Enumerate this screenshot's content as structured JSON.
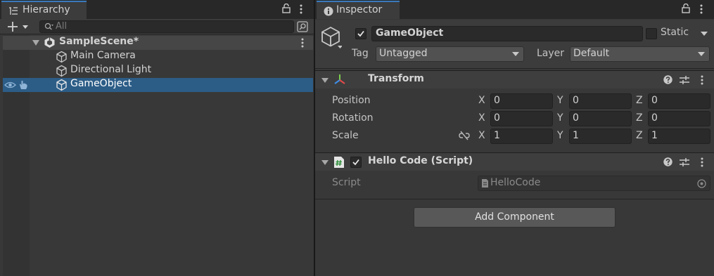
{
  "hierarchy": {
    "tab_label": "Hierarchy",
    "search_placeholder": "All",
    "scene": {
      "name": "SampleScene*"
    },
    "items": [
      {
        "label": "Main Camera"
      },
      {
        "label": "Directional Light"
      },
      {
        "label": "GameObject",
        "selected": true
      }
    ]
  },
  "inspector": {
    "tab_label": "Inspector",
    "object": {
      "active": true,
      "name": "GameObject",
      "static_label": "Static",
      "static_checked": false,
      "tag_label": "Tag",
      "tag_value": "Untagged",
      "layer_label": "Layer",
      "layer_value": "Default"
    },
    "transform": {
      "title": "Transform",
      "axis_labels": {
        "x": "X",
        "y": "Y",
        "z": "Z"
      },
      "rows": [
        {
          "label": "Position",
          "x": "0",
          "y": "0",
          "z": "0"
        },
        {
          "label": "Rotation",
          "x": "0",
          "y": "0",
          "z": "0"
        },
        {
          "label": "Scale",
          "x": "1",
          "y": "1",
          "z": "1"
        }
      ]
    },
    "script_component": {
      "title": "Hello Code (Script)",
      "enabled": true,
      "field_label": "Script",
      "field_value": "HelloCode"
    },
    "add_component_label": "Add Component"
  },
  "icons": [
    "hierarchy-list-icon",
    "lock-icon",
    "kebab-menu-icon",
    "info-icon",
    "plus-icon",
    "search-icon",
    "scene-unity-icon",
    "gameobject-cube-icon",
    "eye-icon",
    "hand-pick-icon",
    "transform-axes-icon",
    "help-icon",
    "preset-sliders-icon",
    "script-file-icon",
    "object-picker-icon",
    "unlink-icon"
  ],
  "colors": {
    "panel_bg": "#383838",
    "selection": "#2c5d87",
    "tab_accent": "#3a79bb",
    "field_bg": "#2a2a2a"
  }
}
